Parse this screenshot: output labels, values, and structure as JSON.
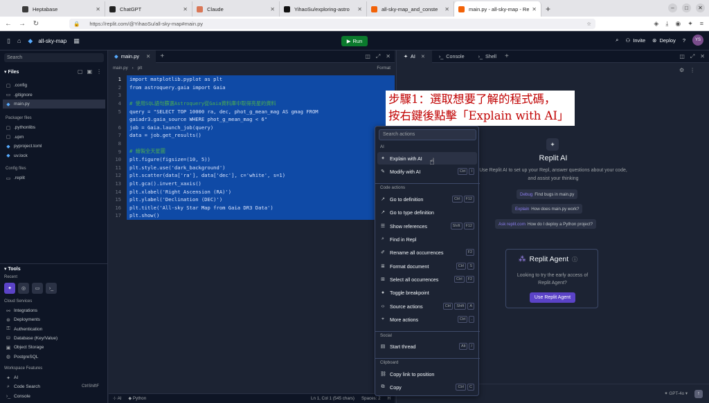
{
  "browser": {
    "tabs": [
      {
        "title": "Heptabase",
        "color": "#3a3a3a"
      },
      {
        "title": "ChatGPT",
        "color": "#222222"
      },
      {
        "title": "Claude",
        "color": "#d97757"
      },
      {
        "title": "YihaoSu/exploring-astro",
        "color": "#111111"
      },
      {
        "title": "all-sky-map_and_conste",
        "color": "#f26207"
      },
      {
        "title": "main.py - all-sky-map - Re",
        "color": "#f26207"
      }
    ],
    "new_tab": "+",
    "url": "https://replit.com/@YihaoSu/all-sky-map#main.py"
  },
  "header": {
    "repl_name": "all-sky-map",
    "run_label": "Run",
    "invite_label": "Invite",
    "deploy_label": "Deploy",
    "avatar_initials": "YS"
  },
  "sidebar": {
    "search_placeholder": "Search",
    "files_title": "Files",
    "files": [
      ".config",
      ".gitignore",
      "main.py"
    ],
    "packager_title": "Packager files",
    "packager_files": [
      ".pythonlibs",
      ".upm",
      "pyproject.toml",
      "uv.lock"
    ],
    "config_title": "Config files",
    "config_files": [
      ".replit"
    ],
    "tools_title": "Tools",
    "recent_title": "Recent",
    "cloud_title": "Cloud Services",
    "cloud_items": [
      "Integrations",
      "Deployments",
      "Authentication",
      "Database (Key/Value)",
      "Object Storage",
      "PostgreSQL"
    ],
    "workspace_title": "Workspace Features",
    "workspace_items": [
      "AI",
      "Code Search",
      "Console"
    ],
    "code_search_shortcut": "CtrlShiftF"
  },
  "editor": {
    "tab_label": "main.py",
    "breadcrumb_file": "main.py",
    "breadcrumb_symbol": "plt",
    "format_label": "Format",
    "lines": [
      "import matplotlib.pyplot as plt",
      "from astroquery.gaia import Gaia",
      "",
      "# 使用SQL語句篩選Astroquery從Gaia資料庫中取得亮星的資料",
      "query = \"SELECT TOP 10000 ra, dec, phot_g_mean_mag AS gmag FROM",
      "gaiadr3.gaia_source WHERE phot_g_mean_mag < 6\"",
      "job = Gaia.launch_job(query)",
      "data = job.get_results()",
      "",
      "# 繪製全天星圖",
      "plt.figure(figsize=(10, 5))",
      "plt.style.use('dark_background')",
      "plt.scatter(data['ra'], data['dec'], c='white', s=1)",
      "plt.gca().invert_xaxis()",
      "plt.xlabel('Right Ascension (RA)')",
      "plt.ylabel('Declination (DEC)')",
      "plt.title('All-sky Star Map from Gaia DR3 Data')",
      "plt.show()"
    ],
    "line_numbers": [
      "1",
      "2",
      "3",
      "4",
      "5",
      "",
      "6",
      "7",
      "8",
      "9",
      "10",
      "11",
      "12",
      "13",
      "14",
      "15",
      "16",
      "17"
    ],
    "status_ai": "AI",
    "status_lang": "Python",
    "status_pos": "Ln 1, Col 1 (545 chars)",
    "status_spaces": "Spaces: 2",
    "status_extra": "H"
  },
  "right_panel": {
    "tabs": [
      "AI",
      "Console",
      "Shell"
    ],
    "ai_title": "Replit AI",
    "ai_description": "Use Replit AI to set up your Repl, answer questions about your code, and assist your thinking",
    "suggestions": [
      {
        "key": "Debug",
        "text": "Find bugs in main.py"
      },
      {
        "key": "Explain",
        "text": "How does main.py work?"
      },
      {
        "key": "Ask replit.com",
        "text": "How do I deploy a Python project?"
      }
    ],
    "agent_title": "Replit Agent",
    "agent_description": "Looking to try the early access of Replit Agent?",
    "agent_button": "Use Replit Agent",
    "model_label": "GPT-4o"
  },
  "context_menu": {
    "search_placeholder": "Search actions",
    "groups": {
      "ai": "AI",
      "code_actions": "Code actions",
      "social": "Social",
      "clipboard": "Clipboard"
    },
    "items": [
      {
        "label": "Explain with AI",
        "icon": "sparkle-icon",
        "shortcut": []
      },
      {
        "label": "Modify with AI",
        "icon": "wand-icon",
        "shortcut": [
          "Ctrl",
          "I"
        ]
      },
      {
        "label": "Go to definition",
        "icon": "external-link-icon",
        "shortcut": [
          "Ctrl",
          "F12"
        ]
      },
      {
        "label": "Go to type definition",
        "icon": "external-link-icon",
        "shortcut": []
      },
      {
        "label": "Show references",
        "icon": "list-icon",
        "shortcut": [
          "Shift",
          "F12"
        ]
      },
      {
        "label": "Find in Repl",
        "icon": "search-icon",
        "shortcut": []
      },
      {
        "label": "Rename all occurrences",
        "icon": "pencil-icon",
        "shortcut": [
          "F2"
        ]
      },
      {
        "label": "Format document",
        "icon": "format-icon",
        "shortcut": [
          "Ctrl",
          "S"
        ]
      },
      {
        "label": "Select all occurrences",
        "icon": "select-icon",
        "shortcut": [
          "Ctrl",
          "F2"
        ]
      },
      {
        "label": "Toggle breakpoint",
        "icon": "dot-icon",
        "shortcut": []
      },
      {
        "label": "Source actions",
        "icon": "code-icon",
        "shortcut": [
          "Ctrl",
          "Shift",
          "A"
        ]
      },
      {
        "label": "More actions",
        "icon": "pin-icon",
        "shortcut": [
          "Ctrl",
          "."
        ]
      },
      {
        "label": "Start thread",
        "icon": "comment-icon",
        "shortcut": [
          "Alt",
          "/"
        ]
      },
      {
        "label": "Copy link to position",
        "icon": "link-icon",
        "shortcut": []
      },
      {
        "label": "Copy",
        "icon": "copy-icon",
        "shortcut": [
          "Ctrl",
          "C"
        ]
      }
    ]
  },
  "annotation": {
    "line1": "步驟1：選取想要了解的程式碼，",
    "line2": "按右鍵後點擊「Explain with AI」"
  }
}
